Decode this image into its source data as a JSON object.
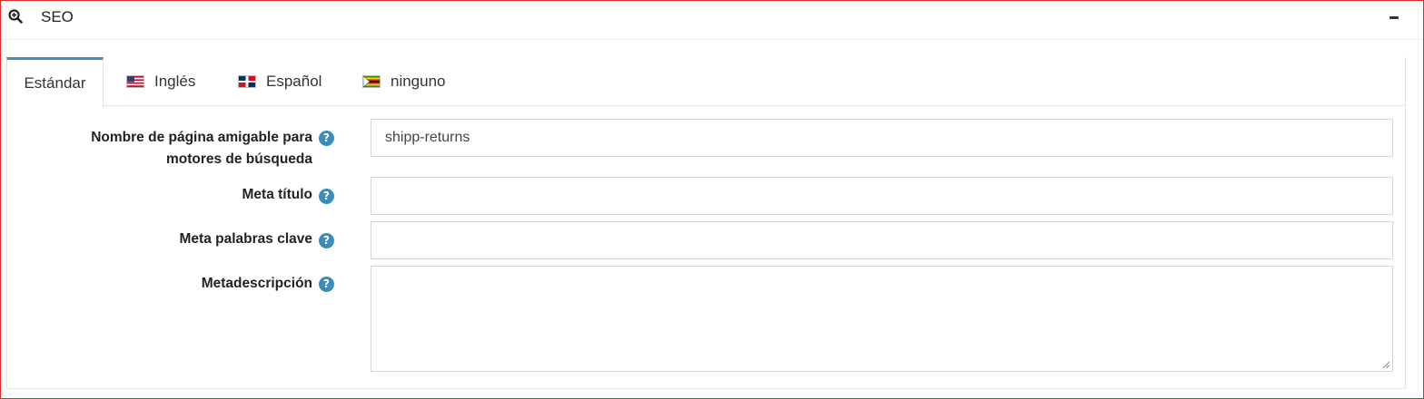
{
  "panel": {
    "title": "SEO",
    "header_icon": "zoom-in-icon",
    "collapse_icon": "minus-icon"
  },
  "tabs": [
    {
      "label": "Estándar",
      "active": true,
      "flag": null
    },
    {
      "label": "Inglés",
      "active": false,
      "flag": "us-flag-icon"
    },
    {
      "label": "Español",
      "active": false,
      "flag": "dominican-republic-flag-icon"
    },
    {
      "label": "ninguno",
      "active": false,
      "flag": "zimbabwe-flag-icon"
    }
  ],
  "fields": {
    "seo_name": {
      "label_line1": "Nombre de página amigable para",
      "label_line2": "motores de búsqueda",
      "value": "shipp-returns",
      "help": "help-icon"
    },
    "meta_title": {
      "label": "Meta título",
      "value": "",
      "help": "help-icon"
    },
    "meta_keywords": {
      "label": "Meta palabras clave",
      "value": "",
      "help": "help-icon"
    },
    "meta_description": {
      "label": "Metadescripción",
      "value": "",
      "help": "help-icon"
    }
  },
  "colors": {
    "accent": "#3c8dbc",
    "frame_border": "#d9302a"
  }
}
